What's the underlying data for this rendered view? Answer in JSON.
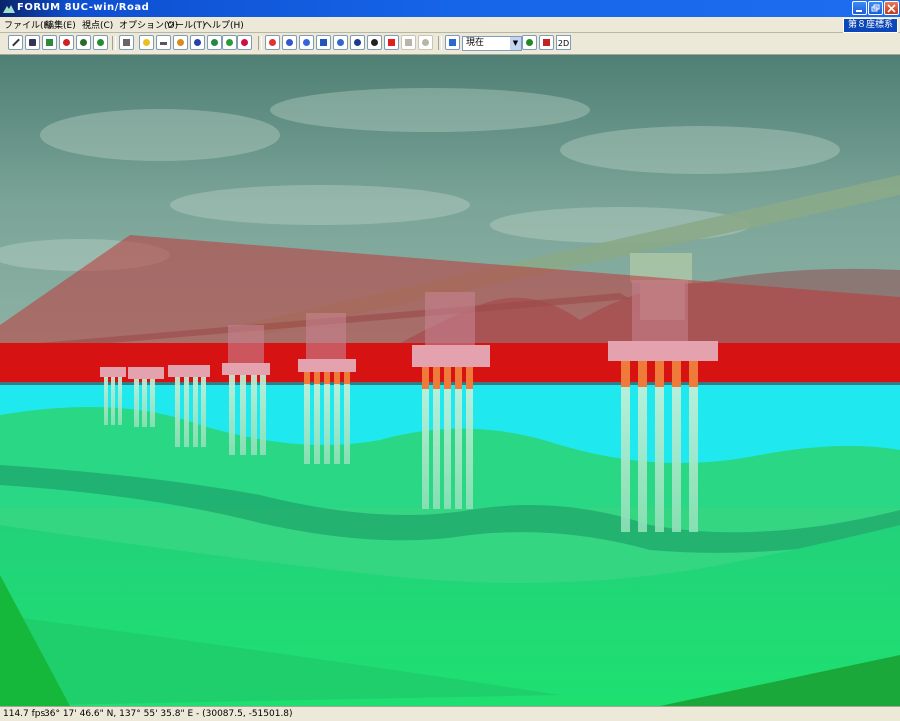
{
  "titlebar": {
    "brand": "FORUM 8",
    "app": "UC-win/Road"
  },
  "menu": [
    {
      "label": "ファイル(F)"
    },
    {
      "label": "編集(E)"
    },
    {
      "label": "視点(C)"
    },
    {
      "label": "オプション(O)"
    },
    {
      "label": "ツール(T)"
    },
    {
      "label": "ヘルプ(H)"
    }
  ],
  "coordinate_system": "第８座標系",
  "toolbar": {
    "view_select": "現在",
    "button_2d": "2D"
  },
  "status": {
    "fps": "114.7 fps",
    "coords": "36°  17' 46.6\" N, 137°  55' 35.8\" E  -  (30087.5, -51501.8)"
  },
  "colors": {
    "sky": "#6f9a8c",
    "red_layer": "#d01010",
    "water": "#1ee9f0",
    "ground": "#27e078",
    "piles": "#a8e6c4",
    "pile_tops": "#f07a3a",
    "pier_caps": "#e29aa8"
  }
}
